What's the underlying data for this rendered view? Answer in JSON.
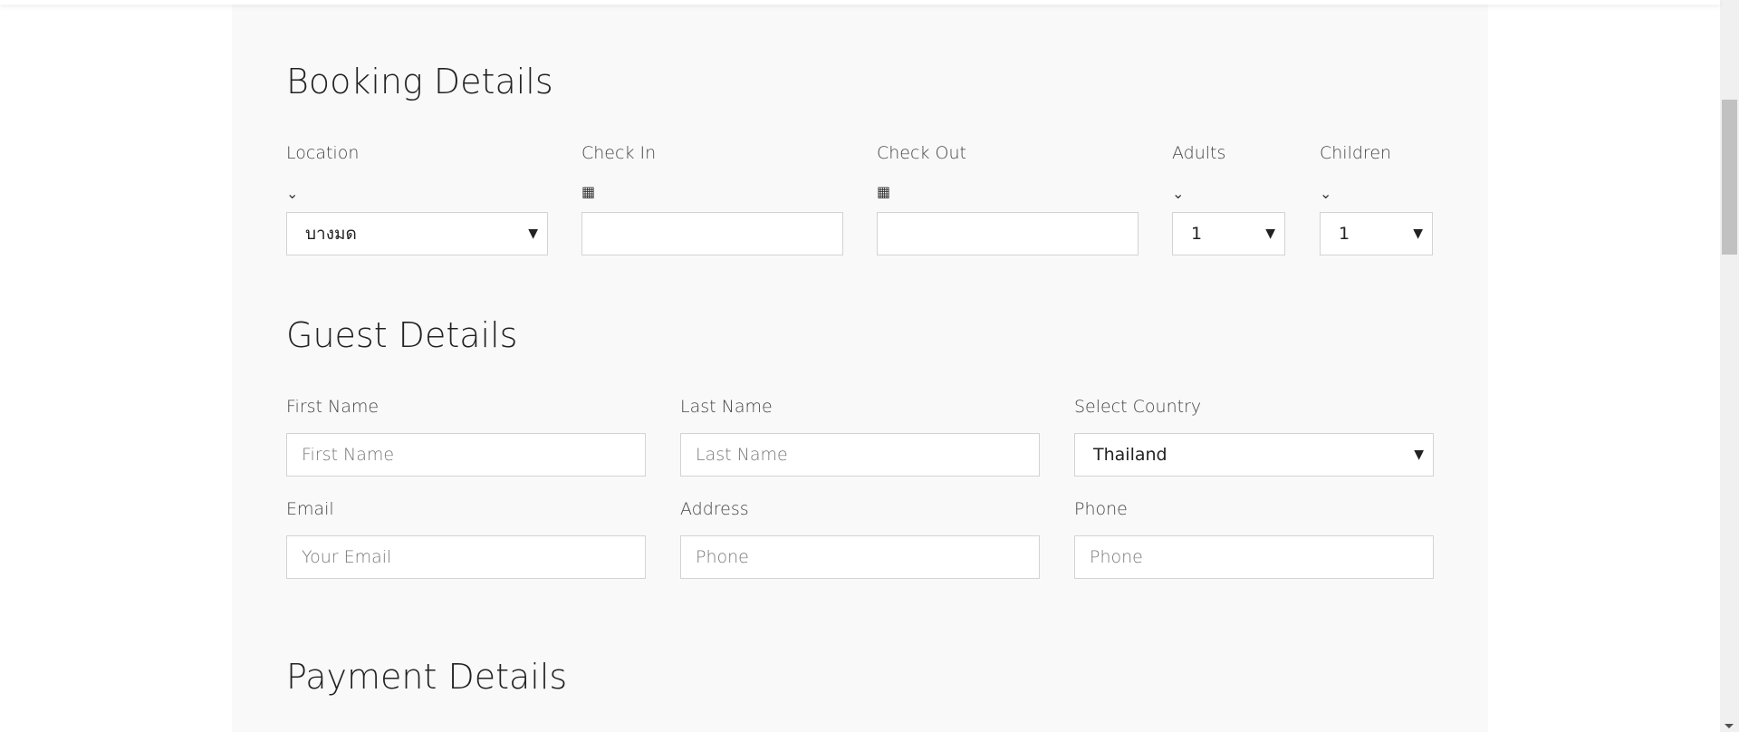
{
  "booking": {
    "title": "Booking Details",
    "location": {
      "label": "Location",
      "value": "บางมด"
    },
    "checkin": {
      "label": "Check In",
      "value": ""
    },
    "checkout": {
      "label": "Check Out",
      "value": ""
    },
    "adults": {
      "label": "Adults",
      "value": "1"
    },
    "children": {
      "label": "Children",
      "value": "1"
    }
  },
  "guest": {
    "title": "Guest Details",
    "first_name": {
      "label": "First Name",
      "placeholder": "First Name"
    },
    "last_name": {
      "label": "Last Name",
      "placeholder": "Last Name"
    },
    "country": {
      "label": "Select Country",
      "value": "Thailand"
    },
    "email": {
      "label": "Email",
      "placeholder": "Your Email"
    },
    "address": {
      "label": "Address",
      "placeholder": "Phone"
    },
    "phone": {
      "label": "Phone",
      "placeholder": "Phone"
    }
  },
  "payment": {
    "title": "Payment Details"
  },
  "icons": {
    "chevron": "chevron-down-icon",
    "calendar": "calendar-icon"
  }
}
